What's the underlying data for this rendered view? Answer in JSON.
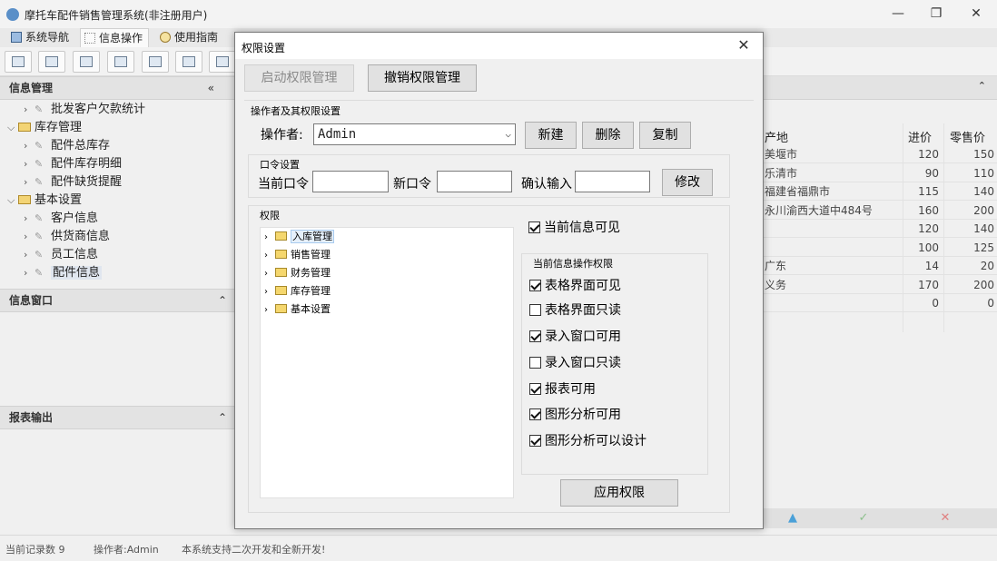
{
  "window": {
    "title": "摩托车配件销售管理系统(非注册用户)",
    "minimize": "—",
    "restore": "❐",
    "close": "✕"
  },
  "tabs": [
    {
      "label": "系统导航",
      "icon": "monitor-icon"
    },
    {
      "label": "信息操作",
      "icon": "grid-icon"
    },
    {
      "label": "使用指南",
      "icon": "clock-icon"
    }
  ],
  "left": {
    "info_header": "信息管理",
    "info_collapse": "«",
    "tree": [
      {
        "label": "批发客户欠款统计",
        "level": 2,
        "type": "tool"
      },
      {
        "label": "库存管理",
        "level": 1,
        "type": "folder",
        "expanded": true
      },
      {
        "label": "配件总库存",
        "level": 2,
        "type": "tool"
      },
      {
        "label": "配件库存明细",
        "level": 2,
        "type": "tool"
      },
      {
        "label": "配件缺货提醒",
        "level": 2,
        "type": "tool"
      },
      {
        "label": "基本设置",
        "level": 1,
        "type": "folder",
        "expanded": true
      },
      {
        "label": "客户信息",
        "level": 2,
        "type": "tool"
      },
      {
        "label": "供货商信息",
        "level": 2,
        "type": "tool"
      },
      {
        "label": "员工信息",
        "level": 2,
        "type": "tool"
      },
      {
        "label": "配件信息",
        "level": 2,
        "type": "tool",
        "selected": true
      }
    ],
    "window_header": "信息窗口",
    "report_header": "报表输出",
    "collapse_up": "⌃"
  },
  "grid": {
    "headers": [
      "产地",
      "进价",
      "零售价"
    ],
    "rows": [
      [
        "美堰市",
        "120",
        "150"
      ],
      [
        "乐清市",
        "90",
        "110"
      ],
      [
        "福建省福鼎市",
        "115",
        "140"
      ],
      [
        "永川渝西大道中484号",
        "160",
        "200"
      ],
      [
        "",
        "120",
        "140"
      ],
      [
        "",
        "100",
        "125"
      ],
      [
        "广东",
        "14",
        "20"
      ],
      [
        "义务",
        "170",
        "200"
      ],
      [
        "",
        "0",
        "0"
      ]
    ],
    "footer": [
      "▲",
      "✓",
      "✕"
    ]
  },
  "status": {
    "records": "当前记录数 9",
    "operator": "操作者:Admin",
    "notice": "本系统支持二次开发和全新开发!"
  },
  "dialog": {
    "title": "权限设置",
    "close": "✕",
    "btn_enable": "启动权限管理",
    "btn_revoke": "撤销权限管理",
    "op_group": "操作者及其权限设置",
    "op_label": "操作者:",
    "op_value": "Admin",
    "btn_new": "新建",
    "btn_delete": "删除",
    "btn_copy": "复制",
    "pwd_group": "口令设置",
    "pwd_current": "当前口令",
    "pwd_new": "新口令",
    "pwd_confirm": "确认输入",
    "btn_modify": "修改",
    "perm_group": "权限",
    "perm_tree": [
      "入库管理",
      "销售管理",
      "财务管理",
      "库存管理",
      "基本设置"
    ],
    "visible_label": "当前信息可见",
    "visible_checked": true,
    "ops_group": "当前信息操作权限",
    "ops": [
      {
        "label": "表格界面可见",
        "checked": true
      },
      {
        "label": "表格界面只读",
        "checked": false
      },
      {
        "label": "录入窗口可用",
        "checked": true
      },
      {
        "label": "录入窗口只读",
        "checked": false
      },
      {
        "label": "报表可用",
        "checked": true
      },
      {
        "label": "图形分析可用",
        "checked": true
      },
      {
        "label": "图形分析可以设计",
        "checked": true
      }
    ],
    "btn_apply": "应用权限"
  }
}
